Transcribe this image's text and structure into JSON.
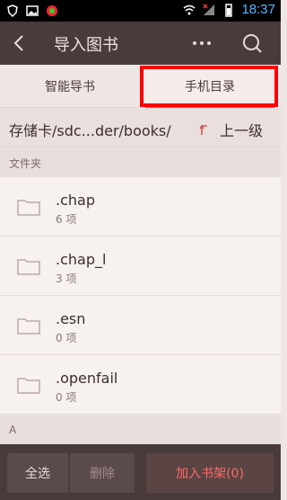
{
  "status_bar": {
    "time": "18:37"
  },
  "topbar": {
    "title": "导入图书"
  },
  "tabs": [
    {
      "label": "智能导书"
    },
    {
      "label": "手机目录"
    }
  ],
  "path": {
    "text": "存储卡/sdc...der/books/",
    "up_label": "上一级"
  },
  "sections": {
    "folders": "文件夹",
    "letter": "A"
  },
  "folders": [
    {
      "name": ".chap",
      "count": "6 项"
    },
    {
      "name": ".chap_l",
      "count": "3 项"
    },
    {
      "name": ".esn",
      "count": "0 项"
    },
    {
      "name": ".openfail",
      "count": "0 项"
    }
  ],
  "bottom": {
    "select_all": "全选",
    "delete": "删除",
    "add_shelf": "加入书架(0)"
  },
  "colors": {
    "header": "#4a3b3b",
    "accent": "#c7605a",
    "highlight": "#ff0000",
    "time": "#58b6ff"
  },
  "icons": {
    "back": "chevron-left-icon",
    "more": "more-dots-icon",
    "search": "search-icon",
    "folder": "folder-icon",
    "up": "up-arrow-icon"
  }
}
